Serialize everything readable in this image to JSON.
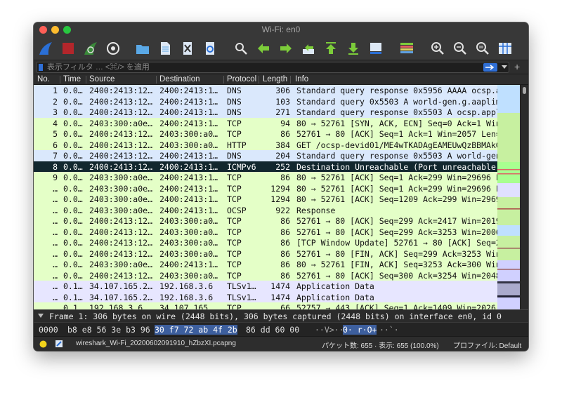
{
  "window": {
    "title": "Wi-Fi: en0"
  },
  "filter": {
    "placeholder": "表示フィルタ … <⌘/> を適用"
  },
  "columns": [
    "No.",
    "Time",
    "Source",
    "Destination",
    "Protocol",
    "Length",
    "Info"
  ],
  "packets": [
    {
      "no": "1",
      "time": "0.0…",
      "src": "2400:2413:12…",
      "dst": "2400:2413:1…",
      "proto": "DNS",
      "len": "306",
      "info": "Standard query response 0x5956 AAAA ocsp.ap",
      "color": "#dae8fc",
      "selected": false
    },
    {
      "no": "2",
      "time": "0.0…",
      "src": "2400:2413:12…",
      "dst": "2400:2413:1…",
      "proto": "DNS",
      "len": "103",
      "info": "Standard query 0x5503 A world-gen.g.aaplimg",
      "color": "#dae8fc",
      "selected": false
    },
    {
      "no": "3",
      "time": "0.0…",
      "src": "2400:2413:12…",
      "dst": "2400:2413:1…",
      "proto": "DNS",
      "len": "271",
      "info": "Standard query response 0x5503 A ocsp.apple",
      "color": "#dae8fc",
      "selected": false
    },
    {
      "no": "4",
      "time": "0.0…",
      "src": "2403:300:a0e…",
      "dst": "2400:2413:1…",
      "proto": "TCP",
      "len": "94",
      "info": "80 → 52761 [SYN, ACK, ECN] Seq=0 Ack=1 Win=",
      "color": "#e4ffc7",
      "selected": false
    },
    {
      "no": "5",
      "time": "0.0…",
      "src": "2400:2413:12…",
      "dst": "2403:300:a0…",
      "proto": "TCP",
      "len": "86",
      "info": "52761 → 80 [ACK] Seq=1 Ack=1 Win=2057 Len=0",
      "color": "#e4ffc7",
      "selected": false
    },
    {
      "no": "6",
      "time": "0.0…",
      "src": "2400:2413:12…",
      "dst": "2403:300:a0…",
      "proto": "HTTP",
      "len": "384",
      "info": "GET /ocsp-devid01/ME4wTKADAgEAMEUwQzBBMAkGB",
      "color": "#e4ffc7",
      "selected": false
    },
    {
      "no": "7",
      "time": "0.0…",
      "src": "2400:2413:12…",
      "dst": "2400:2413:1…",
      "proto": "DNS",
      "len": "204",
      "info": "Standard query response 0x5503 A world-gen.",
      "color": "#dae8fc",
      "selected": false
    },
    {
      "no": "8",
      "time": "0.0…",
      "src": "2400:2413:12…",
      "dst": "2400:2413:1…",
      "proto": "ICMPv6",
      "len": "252",
      "info": "Destination Unreachable (Port unreachable)",
      "color": "#12272e",
      "selected": true
    },
    {
      "no": "9",
      "time": "0.0…",
      "src": "2403:300:a0e…",
      "dst": "2400:2413:1…",
      "proto": "TCP",
      "len": "86",
      "info": "80 → 52761 [ACK] Seq=1 Ack=299 Win=29696 Le",
      "color": "#e4ffc7",
      "selected": false
    },
    {
      "no": "…",
      "time": "0.0…",
      "src": "2403:300:a0e…",
      "dst": "2400:2413:1…",
      "proto": "TCP",
      "len": "1294",
      "info": "80 → 52761 [ACK] Seq=1 Ack=299 Win=29696 Le",
      "color": "#e4ffc7",
      "selected": false
    },
    {
      "no": "…",
      "time": "0.0…",
      "src": "2403:300:a0e…",
      "dst": "2400:2413:1…",
      "proto": "TCP",
      "len": "1294",
      "info": "80 → 52761 [ACK] Seq=1209 Ack=299 Win=2969",
      "color": "#e4ffc7",
      "selected": false
    },
    {
      "no": "…",
      "time": "0.0…",
      "src": "2403:300:a0e…",
      "dst": "2400:2413:1…",
      "proto": "OCSP",
      "len": "922",
      "info": "Response",
      "color": "#e4ffc7",
      "selected": false
    },
    {
      "no": "…",
      "time": "0.0…",
      "src": "2400:2413:12…",
      "dst": "2403:300:a0…",
      "proto": "TCP",
      "len": "86",
      "info": "52761 → 80 [ACK] Seq=299 Ack=2417 Win=2019",
      "color": "#e4ffc7",
      "selected": false
    },
    {
      "no": "…",
      "time": "0.0…",
      "src": "2400:2413:12…",
      "dst": "2403:300:a0…",
      "proto": "TCP",
      "len": "86",
      "info": "52761 → 80 [ACK] Seq=299 Ack=3253 Win=2006",
      "color": "#e4ffc7",
      "selected": false
    },
    {
      "no": "…",
      "time": "0.0…",
      "src": "2400:2413:12…",
      "dst": "2403:300:a0…",
      "proto": "TCP",
      "len": "86",
      "info": "[TCP Window Update] 52761 → 80 [ACK] Seq=29",
      "color": "#e4ffc7",
      "selected": false
    },
    {
      "no": "…",
      "time": "0.0…",
      "src": "2400:2413:12…",
      "dst": "2403:300:a0…",
      "proto": "TCP",
      "len": "86",
      "info": "52761 → 80 [FIN, ACK] Seq=299 Ack=3253 Win=",
      "color": "#e4ffc7",
      "selected": false
    },
    {
      "no": "…",
      "time": "0.0…",
      "src": "2403:300:a0e…",
      "dst": "2400:2413:1…",
      "proto": "TCP",
      "len": "86",
      "info": "80 → 52761 [FIN, ACK] Seq=3253 Ack=300 Win=",
      "color": "#e4ffc7",
      "selected": false
    },
    {
      "no": "…",
      "time": "0.0…",
      "src": "2400:2413:12…",
      "dst": "2403:300:a0…",
      "proto": "TCP",
      "len": "86",
      "info": "52761 → 80 [ACK] Seq=300 Ack=3254 Win=2048",
      "color": "#e4ffc7",
      "selected": false
    },
    {
      "no": "…",
      "time": "0.1…",
      "src": "34.107.165.2…",
      "dst": "192.168.3.6",
      "proto": "TLSv1…",
      "len": "1474",
      "info": "Application Data",
      "color": "#e7e6ff",
      "selected": false
    },
    {
      "no": "…",
      "time": "0.1…",
      "src": "34.107.165.2…",
      "dst": "192.168.3.6",
      "proto": "TLSv1…",
      "len": "1474",
      "info": "Application Data",
      "color": "#e7e6ff",
      "selected": false
    },
    {
      "no": "…",
      "time": "0.1…",
      "src": "192.168.3.6",
      "dst": "34.107.165…",
      "proto": "TCP",
      "len": "66",
      "info": "52757 → 443 [ACK] Seq=1 Ack=1409 Win=2026 L",
      "color": "#e4ffc7",
      "selected": false
    }
  ],
  "details": {
    "summary": "Frame 1: 306 bytes on wire (2448 bits), 306 bytes captured (2448 bits) on interface en0, id 0"
  },
  "hex": {
    "offset": "0000",
    "bytes_a": "b8 e8 56 3e b3 96",
    "bytes_sel": "30 f7  72 ab 4f 2b",
    "bytes_b": "86 dd 60 00",
    "ascii_a": "··V>··",
    "ascii_sel": "0· r·O+",
    "ascii_b": "··`·"
  },
  "status": {
    "file": "wireshark_Wi-Fi_20200602091910_hZbzXI.pcapng",
    "packets": "パケット数: 655 · 表示: 655 (100.0%)",
    "profile": "プロファイル: Default"
  },
  "colors": {
    "accent": "#2f6fd6",
    "selected_row": "#12272e",
    "selected_text": "#ffffff"
  }
}
